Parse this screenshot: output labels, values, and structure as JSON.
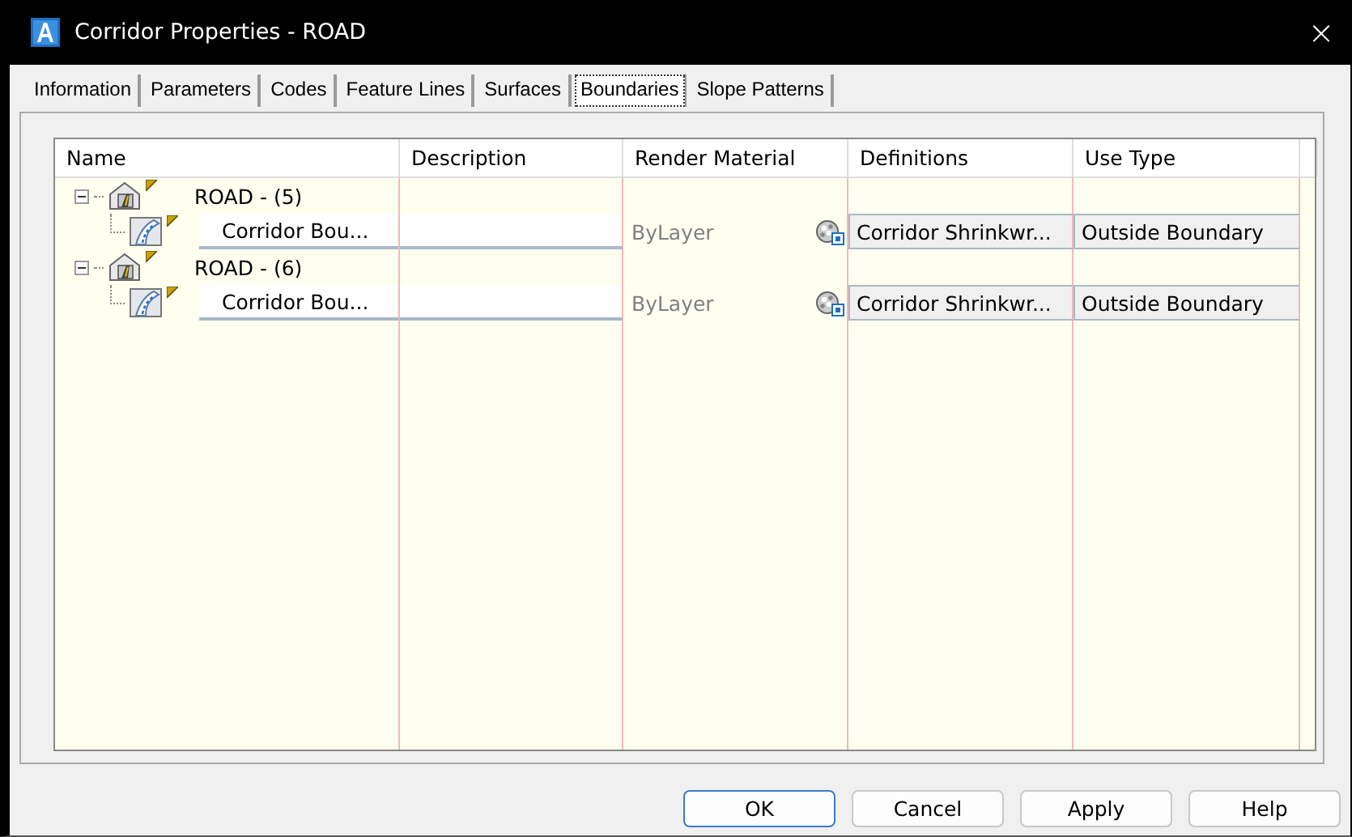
{
  "window": {
    "title": "Corridor Properties - ROAD",
    "close": "×"
  },
  "tabs": [
    {
      "label": "Information",
      "selected": false
    },
    {
      "label": "Parameters",
      "selected": false
    },
    {
      "label": "Codes",
      "selected": false
    },
    {
      "label": "Feature Lines",
      "selected": false
    },
    {
      "label": "Surfaces",
      "selected": false
    },
    {
      "label": "Boundaries",
      "selected": true
    },
    {
      "label": "Slope Patterns",
      "selected": false
    }
  ],
  "table": {
    "columns": [
      "Name",
      "Description",
      "Render Material",
      "Definitions",
      "Use Type"
    ],
    "rows": [
      {
        "name": "ROAD - (5)",
        "expanded": true,
        "children": [
          {
            "name": "Corridor Bou...",
            "render_material": "ByLayer",
            "definitions": "Corridor Shrinkwr...",
            "use_type": "Outside Boundary"
          }
        ]
      },
      {
        "name": "ROAD - (6)",
        "expanded": true,
        "children": [
          {
            "name": "Corridor Bou...",
            "render_material": "ByLayer",
            "definitions": "Corridor Shrinkwr...",
            "use_type": "Outside Boundary"
          }
        ]
      }
    ]
  },
  "buttons": [
    {
      "label": "OK",
      "default": true
    },
    {
      "label": "Cancel",
      "default": false
    },
    {
      "label": "Apply",
      "default": false
    },
    {
      "label": "Help",
      "default": false
    }
  ]
}
